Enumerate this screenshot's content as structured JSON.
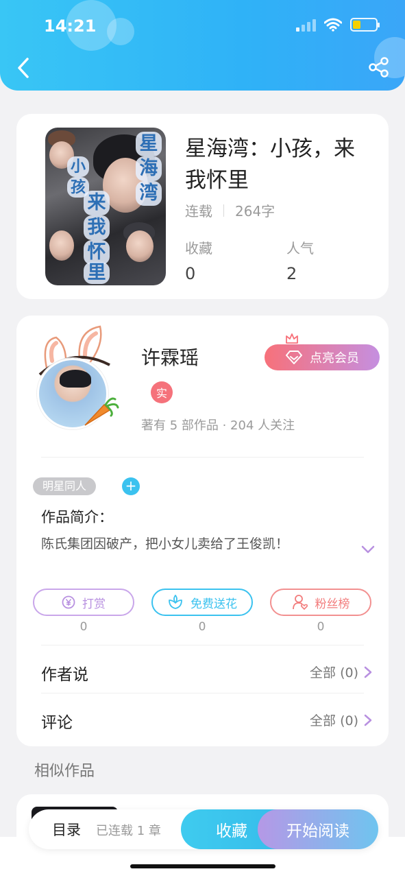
{
  "status_bar": {
    "time": "14:21",
    "battery_color": "#f5d000",
    "battery_level": 0.35
  },
  "header": {
    "back_icon": "chevron-left-icon",
    "share_icon": "share-icon"
  },
  "book": {
    "title": "星海湾：小孩，来我怀里",
    "cover_title_chars": [
      "星",
      "海",
      "湾",
      "小",
      "孩",
      "来",
      "我",
      "怀",
      "里"
    ],
    "status": "连载",
    "word_count": "264字",
    "stats": [
      {
        "label": "收藏",
        "value": "0"
      },
      {
        "label": "人气",
        "value": "2"
      }
    ]
  },
  "author": {
    "name": "许霖瑶",
    "vip_label": "点亮会员",
    "real_badge": "实",
    "summary": "著有 5 部作品 · 204 人关注"
  },
  "work": {
    "tag": "明星同人",
    "add_tag": "+",
    "intro_label": "作品简介：",
    "intro_text": "陈氏集团因破产，把小女儿卖给了王俊凯！"
  },
  "actions": [
    {
      "label": "打赏",
      "count": "0",
      "icon": "yen-coin-icon",
      "color": "#b890e0"
    },
    {
      "label": "免费送花",
      "count": "0",
      "icon": "flower-icon",
      "color": "#3bc2ef"
    },
    {
      "label": "粉丝榜",
      "count": "0",
      "icon": "fan-ranking-icon",
      "color": "#f27c7c"
    }
  ],
  "sections": [
    {
      "title": "作者说",
      "right": "全部 (0)"
    },
    {
      "title": "评论",
      "right": "全部 (0)"
    }
  ],
  "similar": {
    "title": "相似作品"
  },
  "bottom_bar": {
    "toc": "目录",
    "chapters": "已连载 1 章",
    "collect": "收藏",
    "read": "开始阅读"
  },
  "colors": {
    "accent": "#36bdeb",
    "vip": "#f7717a",
    "purple": "#b890e0"
  }
}
